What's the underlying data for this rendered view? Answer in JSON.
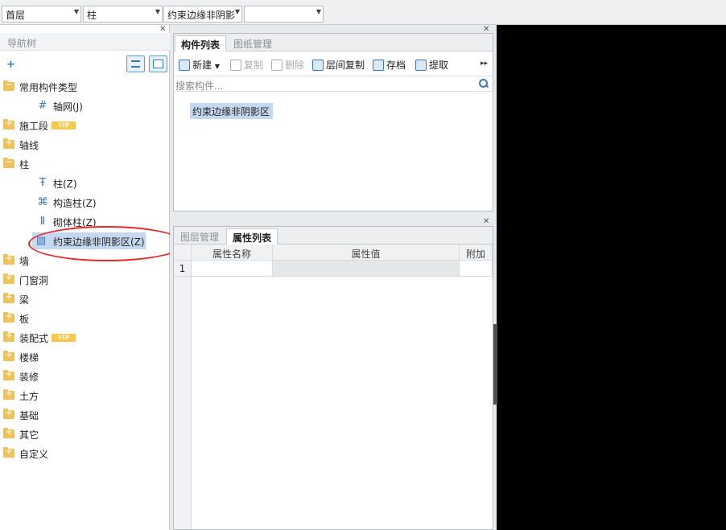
{
  "top_combos": [
    {
      "value": "首层"
    },
    {
      "value": "柱"
    },
    {
      "value": "约束边缘非阴影"
    },
    {
      "value": ""
    }
  ],
  "nav": {
    "title": "导航树",
    "tree": [
      {
        "label": "常用构件类型",
        "type": "folder-open"
      },
      {
        "label": "轴网(J)",
        "type": "leaf",
        "icon": "grid-icon"
      },
      {
        "label": "施工段",
        "type": "folder",
        "badge": "VIP"
      },
      {
        "label": "轴线",
        "type": "folder"
      },
      {
        "label": "柱",
        "type": "folder-open"
      },
      {
        "label": "柱(Z)",
        "type": "leaf",
        "icon": "column-icon"
      },
      {
        "label": "构造柱(Z)",
        "type": "leaf",
        "icon": "constructional-column-icon"
      },
      {
        "label": "砌体柱(Z)",
        "type": "leaf",
        "icon": "masonry-column-icon"
      },
      {
        "label": "约束边缘非阴影区(Z)",
        "type": "leaf",
        "icon": "hatch-region-icon",
        "selected": true
      },
      {
        "label": "墙",
        "type": "folder"
      },
      {
        "label": "门窗洞",
        "type": "folder"
      },
      {
        "label": "梁",
        "type": "folder"
      },
      {
        "label": "板",
        "type": "folder"
      },
      {
        "label": "装配式",
        "type": "folder",
        "badge": "VIP"
      },
      {
        "label": "楼梯",
        "type": "folder"
      },
      {
        "label": "装修",
        "type": "folder"
      },
      {
        "label": "土方",
        "type": "folder"
      },
      {
        "label": "基础",
        "type": "folder"
      },
      {
        "label": "其它",
        "type": "folder"
      },
      {
        "label": "自定义",
        "type": "folder"
      }
    ]
  },
  "component_panel": {
    "tabs": [
      "构件列表",
      "图纸管理"
    ],
    "toolbar": {
      "new": "新建",
      "copy": "复制",
      "delete": "删除",
      "floor_copy": "层间复制",
      "save": "存档",
      "extract": "提取"
    },
    "search_placeholder": "搜索构件...",
    "items": [
      "约束边缘非阴影区"
    ]
  },
  "property_panel": {
    "tabs": [
      "图层管理",
      "属性列表"
    ],
    "columns": [
      "属性名称",
      "属性值",
      "附加"
    ],
    "rows": [
      {
        "index": "1",
        "name": "",
        "value": "",
        "extra": ""
      }
    ]
  },
  "colors": {
    "accent": "#3a78c0",
    "selection": "#c4d9ef",
    "annotation": "#e32b2b",
    "folder": "#f0c35a"
  }
}
